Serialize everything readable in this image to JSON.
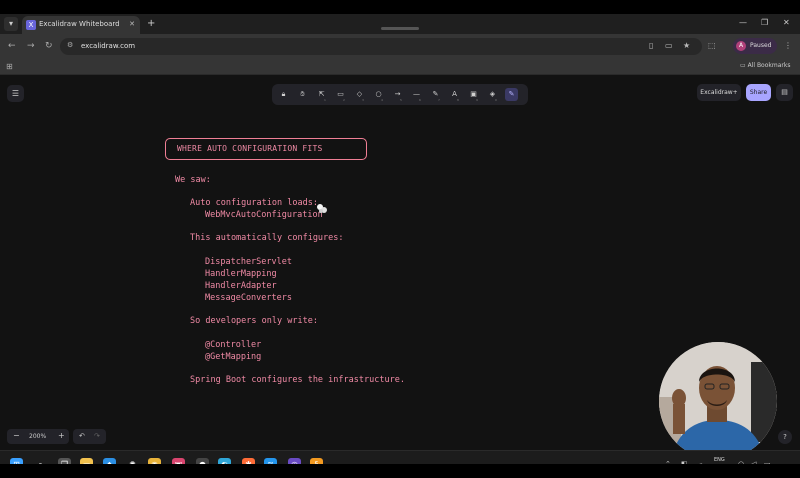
{
  "browser": {
    "tab_title": "Excalidraw Whiteboard",
    "favicon_letter": "X",
    "url": "excalidraw.com",
    "profile_status": "Paused",
    "profile_initial": "A",
    "bookmarks_label": "All Bookmarks"
  },
  "excalidraw": {
    "library_label": "Excalidraw+",
    "share_label": "Share",
    "zoom_value": "200%",
    "tools": [
      {
        "icon": "lock-icon",
        "glyph": "🔒︎",
        "shortcut": ""
      },
      {
        "icon": "hand-icon",
        "glyph": "✋︎",
        "shortcut": ""
      },
      {
        "icon": "selection-icon",
        "glyph": "⇱",
        "shortcut": "1"
      },
      {
        "icon": "rectangle-icon",
        "glyph": "▭",
        "shortcut": "2"
      },
      {
        "icon": "diamond-icon",
        "glyph": "◇",
        "shortcut": "3"
      },
      {
        "icon": "ellipse-icon",
        "glyph": "○",
        "shortcut": "4"
      },
      {
        "icon": "arrow-icon",
        "glyph": "→",
        "shortcut": "5"
      },
      {
        "icon": "line-icon",
        "glyph": "—",
        "shortcut": "6"
      },
      {
        "icon": "pencil-icon",
        "glyph": "✎",
        "shortcut": "7"
      },
      {
        "icon": "text-icon",
        "glyph": "A",
        "shortcut": "8"
      },
      {
        "icon": "image-icon",
        "glyph": "▣",
        "shortcut": "9"
      },
      {
        "icon": "eraser-icon",
        "glyph": "◈",
        "shortcut": "0"
      },
      {
        "icon": "extra-tools-icon",
        "glyph": "✎",
        "shortcut": ""
      }
    ]
  },
  "drawing": {
    "title": "WHERE AUTO CONFIGURATION FITS",
    "lines": [
      {
        "text": "We saw:",
        "indent": 0
      },
      {
        "text": "Auto configuration loads:",
        "indent": 1
      },
      {
        "text": "WebMvcAutoConfiguration",
        "indent": 2
      },
      {
        "text": "This automatically configures:",
        "indent": 1
      },
      {
        "text": "DispatcherServlet",
        "indent": 2
      },
      {
        "text": "HandlerMapping",
        "indent": 2
      },
      {
        "text": "HandlerAdapter",
        "indent": 2
      },
      {
        "text": "MessageConverters",
        "indent": 2
      },
      {
        "text": "So developers only write:",
        "indent": 1
      },
      {
        "text": "@Controller",
        "indent": 2
      },
      {
        "text": "@GetMapping",
        "indent": 2
      },
      {
        "text": "Spring Boot configures the infrastructure.",
        "indent": 1
      }
    ]
  },
  "taskbar": {
    "lang_top": "ENG",
    "lang_bottom": "IN",
    "apps": [
      {
        "icon": "windows-start-icon",
        "color": "#3aa0ff"
      },
      {
        "icon": "search-icon",
        "color": "#1c1c1c"
      },
      {
        "icon": "task-view-icon",
        "color": "#555555"
      },
      {
        "icon": "file-explorer-icon",
        "color": "#f2c14e"
      },
      {
        "icon": "vscode-icon",
        "color": "#2b8fe3"
      },
      {
        "icon": "chatgpt-icon",
        "color": "#1c1c1c"
      },
      {
        "icon": "chrome-icon",
        "color": "#e8b33a"
      },
      {
        "icon": "intellij-icon",
        "color": "#d9456f"
      },
      {
        "icon": "github-icon",
        "color": "#444444"
      },
      {
        "icon": "edge-icon",
        "color": "#2fa6d8"
      },
      {
        "icon": "postman-icon",
        "color": "#ff6c37"
      },
      {
        "icon": "docker-icon",
        "color": "#2496ed"
      },
      {
        "icon": "obs-icon",
        "color": "#6a4bc4"
      },
      {
        "icon": "sublime-icon",
        "color": "#f39a21"
      }
    ]
  }
}
